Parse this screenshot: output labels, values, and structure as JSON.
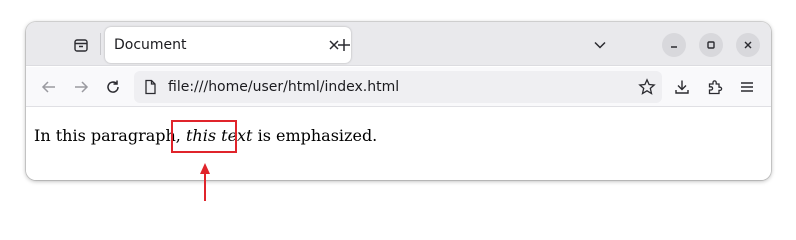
{
  "browser": {
    "tab": {
      "title": "Document"
    },
    "address_bar": {
      "url": "file:///home/user/html/index.html"
    }
  },
  "page": {
    "para_before": "In this paragraph, ",
    "emphasized": "this text",
    "para_after": " is emphasized."
  },
  "annotation": {
    "color": "#e0242b"
  },
  "icons": {
    "tab_list": "tab-list-icon",
    "close_tab": "close-icon",
    "new_tab": "plus-icon",
    "list_all_tabs": "chevron-down-icon",
    "minimize": "minimize-icon",
    "maximize": "maximize-icon",
    "close_window": "close-icon",
    "back": "arrow-left-icon",
    "forward": "arrow-right-icon",
    "reload": "reload-icon",
    "page_icon": "file-icon",
    "bookmark": "star-icon",
    "downloads": "download-icon",
    "extensions": "puzzle-icon",
    "menu": "hamburger-menu-icon"
  }
}
